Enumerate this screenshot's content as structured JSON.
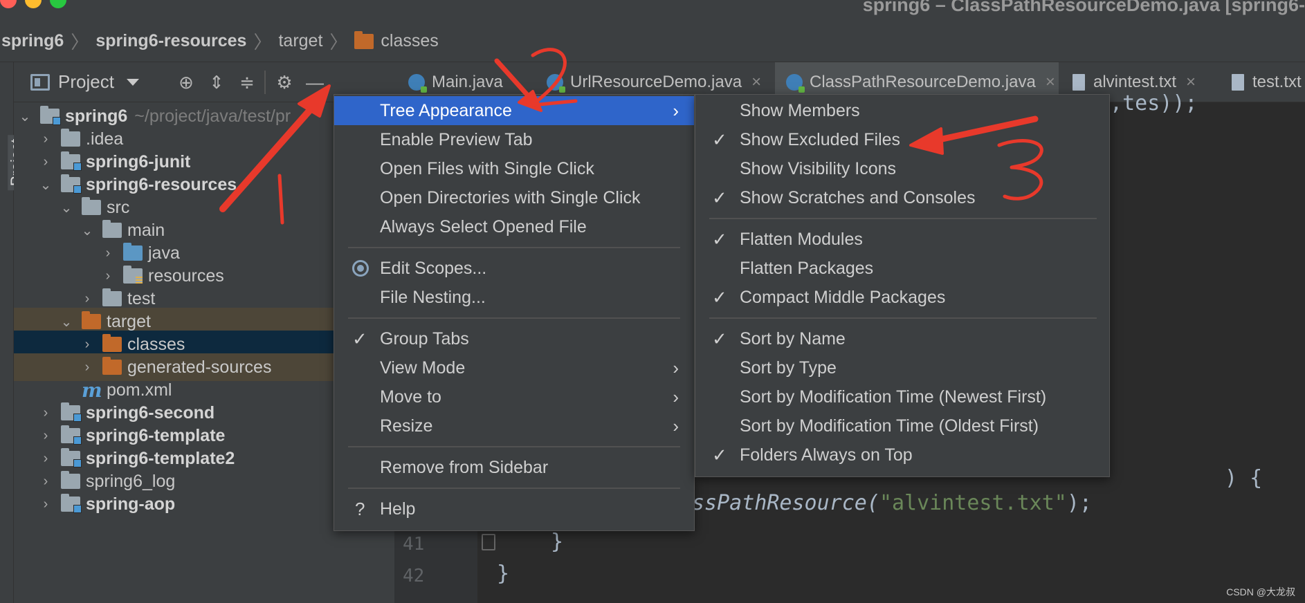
{
  "window": {
    "title": "spring6 – ClassPathResourceDemo.java [spring6-",
    "traffic_colors": [
      "#ff5f57",
      "#febc2e",
      "#28c840"
    ]
  },
  "breadcrumb": [
    "spring6",
    "spring6-resources",
    "target",
    "classes"
  ],
  "project_panel": {
    "title": "Project",
    "side_label": "Project",
    "tools": [
      "locate-icon",
      "expand-all-icon",
      "collapse-all-icon",
      "gear-icon",
      "minimize-icon"
    ]
  },
  "tree": [
    {
      "label": "spring6",
      "path": "~/project/java/test/pr",
      "bold": true,
      "arrow": "down",
      "icon": "module"
    },
    {
      "label": ".idea",
      "arrow": "right",
      "icon": "folder"
    },
    {
      "label": "spring6-junit",
      "bold": true,
      "arrow": "right",
      "icon": "module"
    },
    {
      "label": "spring6-resources",
      "bold": true,
      "arrow": "down",
      "icon": "module"
    },
    {
      "label": "src",
      "arrow": "down",
      "icon": "folder"
    },
    {
      "label": "main",
      "arrow": "down",
      "icon": "folder"
    },
    {
      "label": "java",
      "arrow": "right",
      "icon": "source-folder"
    },
    {
      "label": "resources",
      "arrow": "right",
      "icon": "resources-folder"
    },
    {
      "label": "test",
      "arrow": "right",
      "icon": "folder"
    },
    {
      "label": "target",
      "arrow": "down",
      "icon": "excluded-folder"
    },
    {
      "label": "classes",
      "arrow": "right",
      "icon": "excluded-folder"
    },
    {
      "label": "generated-sources",
      "arrow": "right",
      "icon": "excluded-folder"
    },
    {
      "label": "pom.xml",
      "arrow": "none",
      "icon": "maven"
    },
    {
      "label": "spring6-second",
      "bold": true,
      "arrow": "right",
      "icon": "module"
    },
    {
      "label": "spring6-template",
      "bold": true,
      "arrow": "right",
      "icon": "module"
    },
    {
      "label": "spring6-template2",
      "bold": true,
      "arrow": "right",
      "icon": "module"
    },
    {
      "label": "spring6_log",
      "arrow": "right",
      "icon": "folder"
    },
    {
      "label": "spring-aop",
      "bold": true,
      "arrow": "right",
      "icon": "module"
    }
  ],
  "tabs": [
    {
      "label": "Main.java",
      "icon": "java-class"
    },
    {
      "label": "UrlResourceDemo.java",
      "icon": "java-class"
    },
    {
      "label": "ClassPathResourceDemo.java",
      "icon": "java-class",
      "active": true
    },
    {
      "label": "alvintest.txt",
      "icon": "text-file"
    },
    {
      "label": "test.txt",
      "icon": "text-file"
    }
  ],
  "editor": {
    "line_top_fragment": "b,tes));",
    "line_mid_fragment": ") {",
    "line_41": "41",
    "line_42": "42",
    "code_prefix": "ssPathResource(",
    "code_string": "\"alvintest.txt\"",
    "code_suffix": ");",
    "brace_inner": "}",
    "brace_outer": "}"
  },
  "main_menu": [
    {
      "label": "Tree Appearance",
      "submenu": true,
      "selected": true
    },
    {
      "label": "Enable Preview Tab"
    },
    {
      "label": "Open Files with Single Click"
    },
    {
      "label": "Open Directories with Single Click"
    },
    {
      "label": "Always Select Opened File"
    },
    {
      "separator": true
    },
    {
      "label": "Edit Scopes...",
      "radio": true
    },
    {
      "label": "File Nesting..."
    },
    {
      "separator": true
    },
    {
      "label": "Group Tabs",
      "checked": true
    },
    {
      "label": "View Mode",
      "submenu": true
    },
    {
      "label": "Move to",
      "submenu": true
    },
    {
      "label": "Resize",
      "submenu": true
    },
    {
      "separator": true
    },
    {
      "label": "Remove from Sidebar"
    },
    {
      "separator": true
    },
    {
      "label": "Help",
      "prefix": "?"
    }
  ],
  "sub_menu": [
    {
      "label": "Show Members"
    },
    {
      "label": "Show Excluded Files",
      "checked": true
    },
    {
      "label": "Show Visibility Icons"
    },
    {
      "label": "Show Scratches and Consoles",
      "checked": true
    },
    {
      "separator": true
    },
    {
      "label": "Flatten Modules",
      "checked": true
    },
    {
      "label": "Flatten Packages"
    },
    {
      "label": "Compact Middle Packages",
      "checked": true
    },
    {
      "separator": true
    },
    {
      "label": "Sort by Name",
      "checked": true
    },
    {
      "label": "Sort by Type"
    },
    {
      "label": "Sort by Modification Time (Newest First)"
    },
    {
      "label": "Sort by Modification Time (Oldest First)"
    },
    {
      "label": "Folders Always on Top",
      "checked": true
    }
  ],
  "glyphs": {
    "check": "✓",
    "chevron": "›",
    "sep": "〉",
    "close": "×"
  },
  "annotations": {
    "color": "#e8392b",
    "marks": [
      "1",
      "2",
      "3"
    ]
  },
  "watermark": "CSDN @大龙叔"
}
